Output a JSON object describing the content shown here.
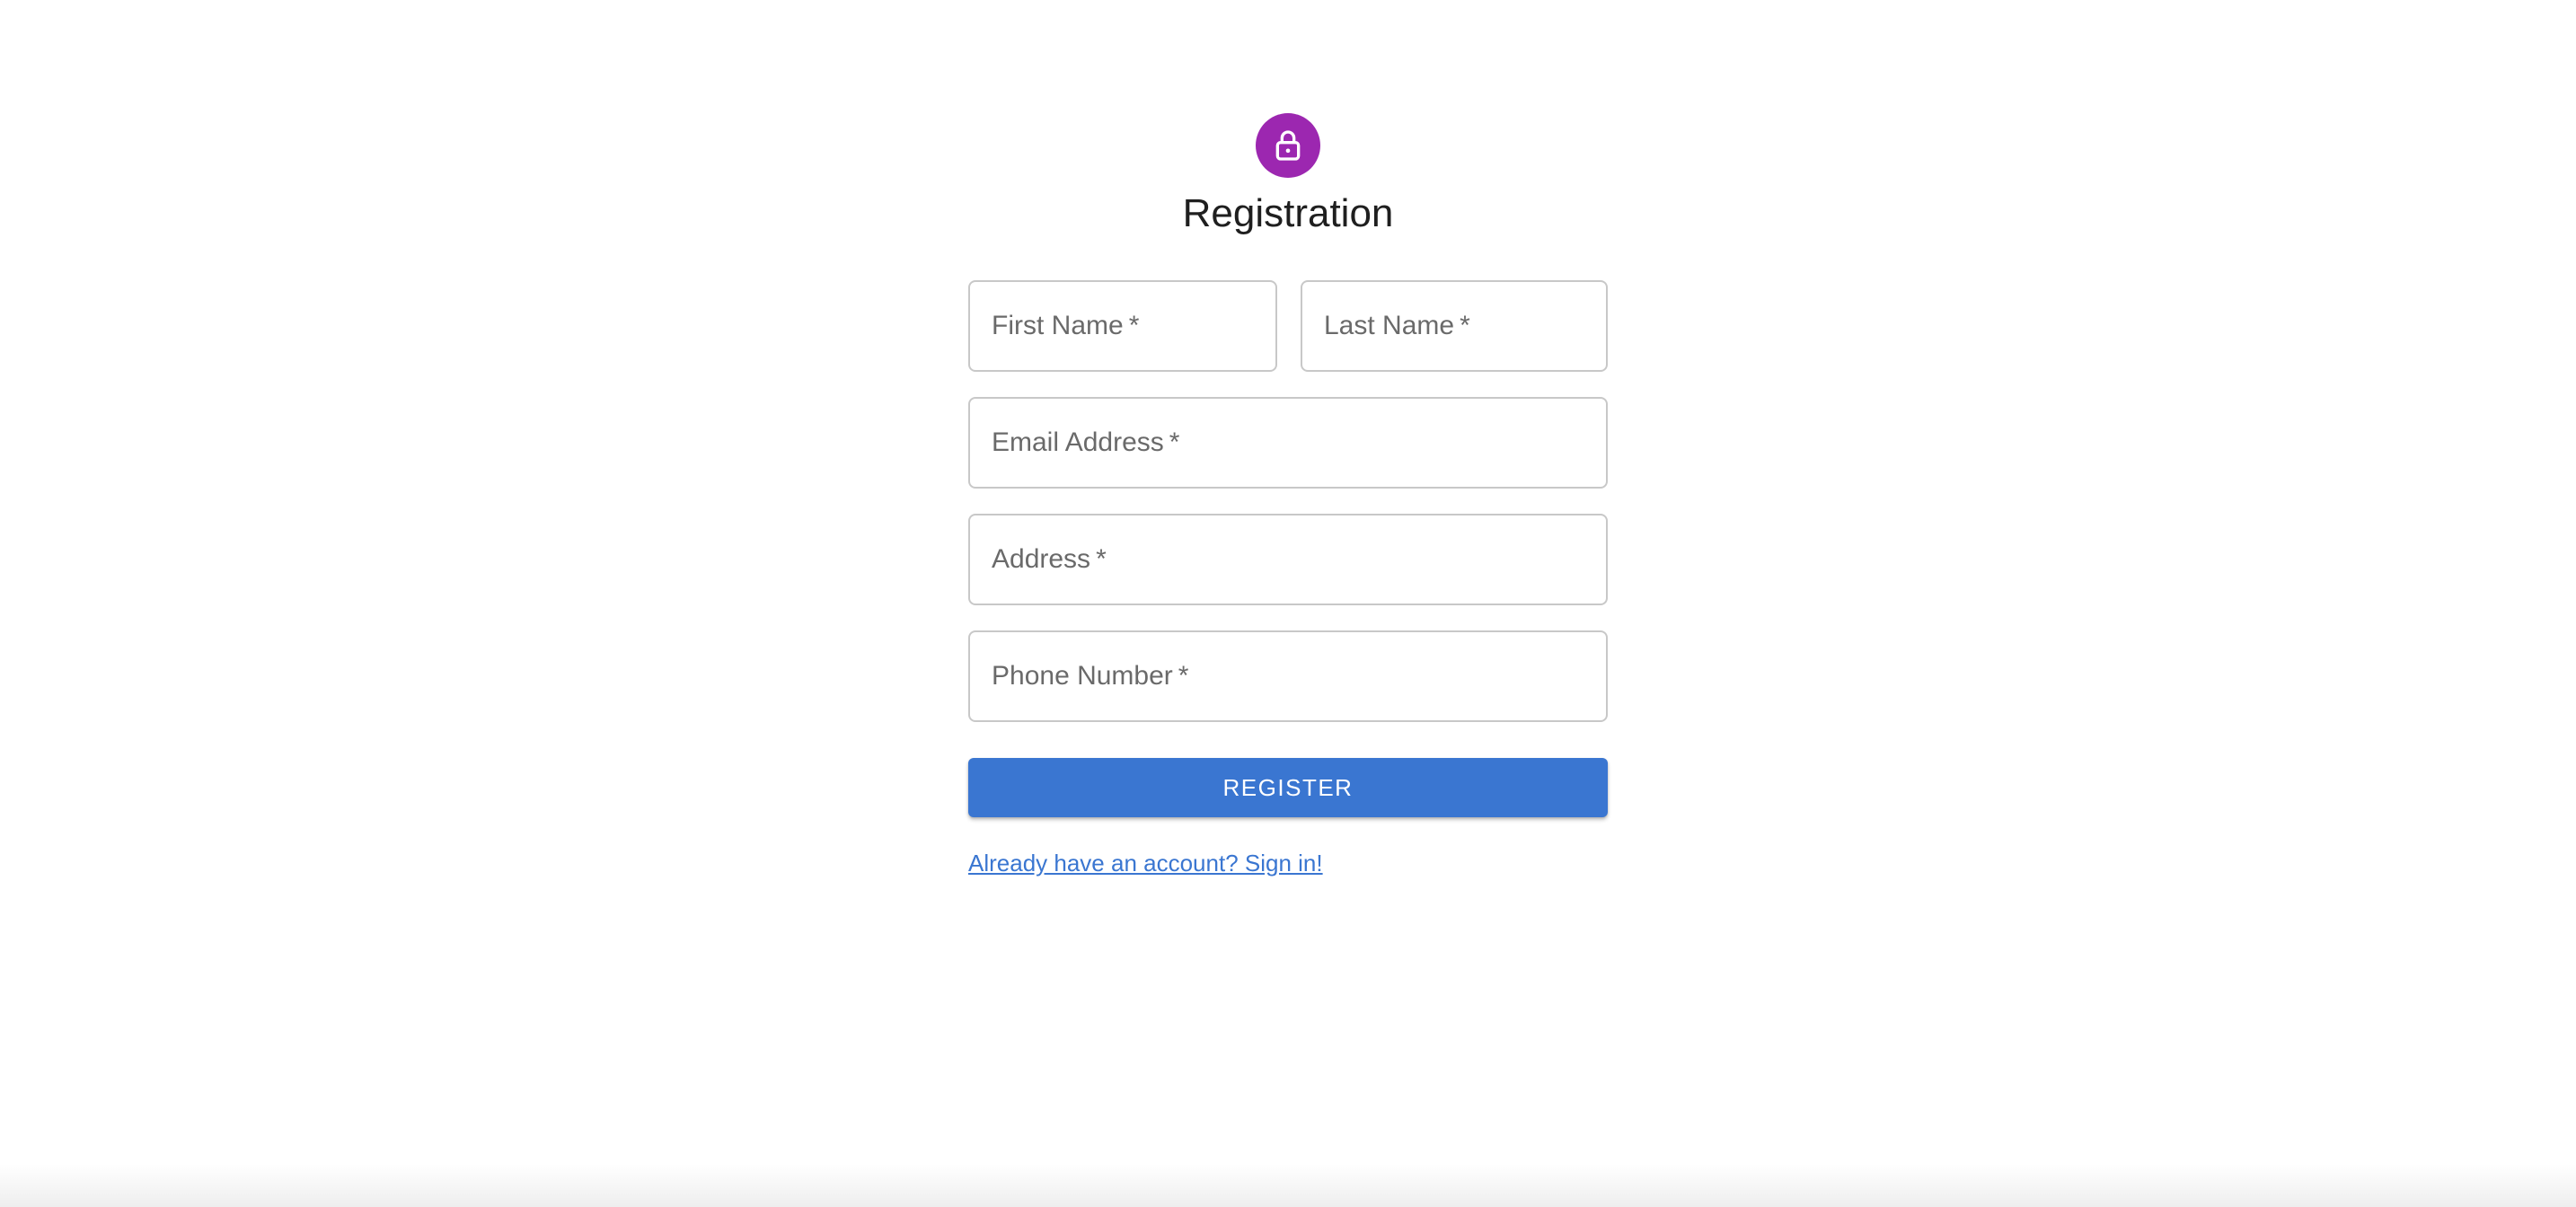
{
  "colors": {
    "avatar_bg": "#9c27b0",
    "primary": "#3a76d1",
    "link": "#3a76d1"
  },
  "header": {
    "icon": "lock-icon",
    "title": "Registration"
  },
  "form": {
    "first_name": {
      "label": "First Name",
      "required_mark": "*",
      "value": ""
    },
    "last_name": {
      "label": "Last Name",
      "required_mark": "*",
      "value": ""
    },
    "email": {
      "label": "Email Address",
      "required_mark": "*",
      "value": ""
    },
    "address": {
      "label": "Address",
      "required_mark": "*",
      "value": ""
    },
    "phone": {
      "label": "Phone Number",
      "required_mark": "*",
      "value": ""
    },
    "submit_label": "REGISTER",
    "signin_link": "Already have an account? Sign in!"
  }
}
